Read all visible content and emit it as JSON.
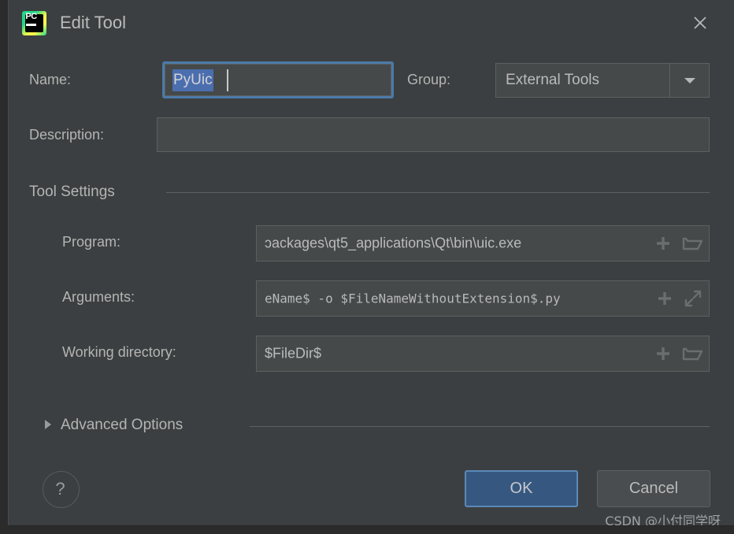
{
  "window": {
    "title": "Edit Tool",
    "app_icon": "pycharm-icon",
    "icon_text": "PC",
    "close_icon": "close-icon"
  },
  "form": {
    "name_label": "Name:",
    "name_value": "PyUic",
    "name_selected": true,
    "group_label": "Group:",
    "group_value": "External Tools",
    "group_dropdown_icon": "chevron-down-icon",
    "description_label": "Description:",
    "description_value": "",
    "description_placeholder": ""
  },
  "tool_settings": {
    "section_title": "Tool Settings",
    "program_label": "Program:",
    "program_value": "ɔackages\\qt5_applications\\Qt\\bin\\uic.exe",
    "program_icons": [
      "plus-icon",
      "folder-icon"
    ],
    "arguments_label": "Arguments:",
    "arguments_value": "eName$ -o $FileNameWithoutExtension$.py",
    "arguments_icons": [
      "plus-icon",
      "expand-icon"
    ],
    "working_dir_label": "Working directory:",
    "working_dir_value": "$FileDir$",
    "working_dir_icons": [
      "plus-icon",
      "folder-icon"
    ]
  },
  "advanced": {
    "label": "Advanced Options",
    "expanded": false,
    "toggle_icon": "triangle-right-icon"
  },
  "footer": {
    "help_label": "?",
    "ok_label": "OK",
    "cancel_label": "Cancel"
  },
  "watermark": {
    "text": "CSDN @小付同学呀"
  },
  "colors": {
    "dialog_bg": "#3c3f41",
    "field_bg": "#45494a",
    "accent_blue": "#365880",
    "focus_ring": "#4b7aa8",
    "selection_blue": "#4b6eaf",
    "text": "#bbbbbb",
    "border": "#5e6060"
  }
}
